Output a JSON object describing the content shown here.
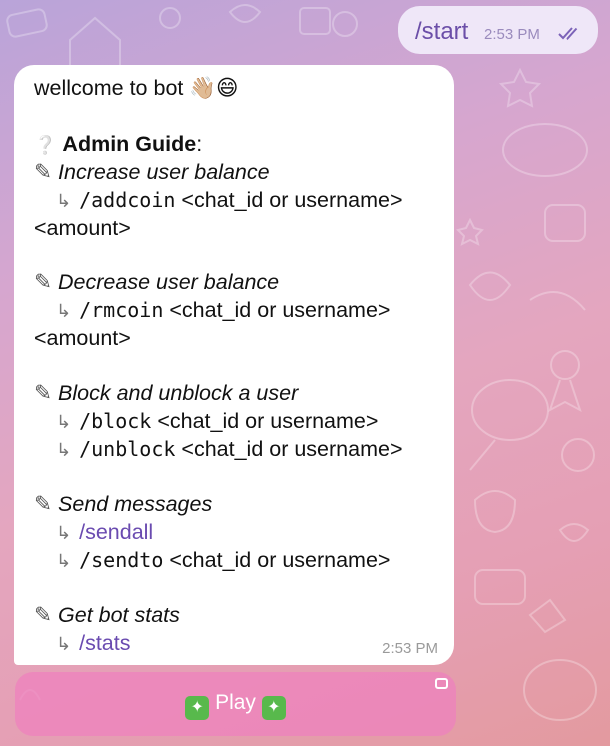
{
  "outgoing": {
    "text": "/start",
    "time": "2:53 PM"
  },
  "incoming": {
    "greeting": "wellcome to bot 👋🏼😄",
    "admin_title": "Admin Guide",
    "admin_colon": ":",
    "sections": [
      {
        "title": "Increase user balance",
        "commands": [
          {
            "cmd": "/addcoin",
            "args": "<chat_id or username>"
          },
          {
            "cont": "<amount>"
          }
        ]
      },
      {
        "title": "Decrease user balance",
        "commands": [
          {
            "cmd": "/rmcoin",
            "args": "<chat_id or username>"
          },
          {
            "cont": "<amount>"
          }
        ]
      },
      {
        "title": "Block and unblock a user",
        "commands": [
          {
            "cmd": "/block",
            "args": "<chat_id or username>"
          },
          {
            "cmd": "/unblock",
            "args": "<chat_id or username>"
          }
        ]
      },
      {
        "title": "Send messages",
        "commands": [
          {
            "link": "/sendall"
          },
          {
            "cmd": "/sendto",
            "args": "<chat_id or username>"
          }
        ]
      },
      {
        "title": "Get bot stats",
        "commands": [
          {
            "link": "/stats"
          }
        ]
      }
    ],
    "time": "2:53 PM"
  },
  "keyboard": {
    "play_label": "Play",
    "play_icon": "sparkle-icon"
  },
  "colors": {
    "link": "#6a4bb0",
    "outgoing_bubble": "#efe7f8",
    "keyboard_button": "#ee82be"
  }
}
